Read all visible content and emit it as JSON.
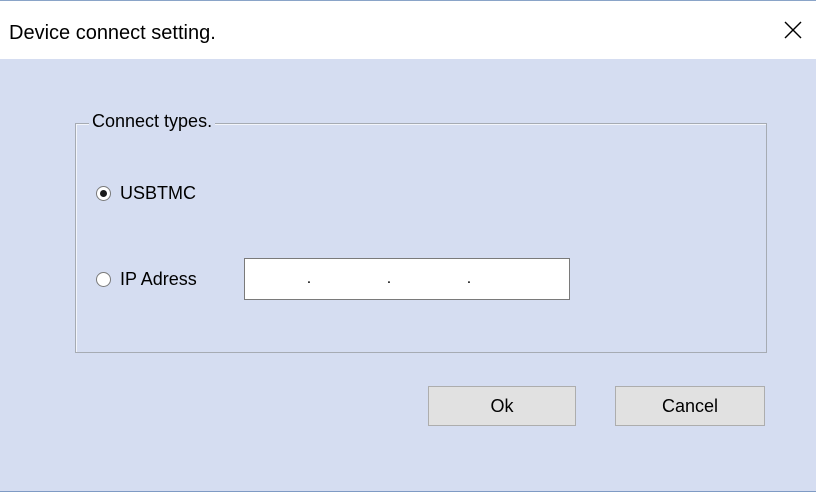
{
  "dialog": {
    "title": "Device connect setting.",
    "close_icon": "close-icon"
  },
  "connect_group": {
    "legend": "Connect types.",
    "options": [
      {
        "label": "USBTMC",
        "selected": true
      },
      {
        "label": "IP Adress",
        "selected": false
      }
    ],
    "ip_address": {
      "octets": [
        "",
        "",
        "",
        ""
      ],
      "separator": "."
    }
  },
  "buttons": {
    "ok_label": "Ok",
    "cancel_label": "Cancel"
  },
  "colors": {
    "client_background": "#d5ddf1",
    "window_border": "#7f9bc4"
  }
}
